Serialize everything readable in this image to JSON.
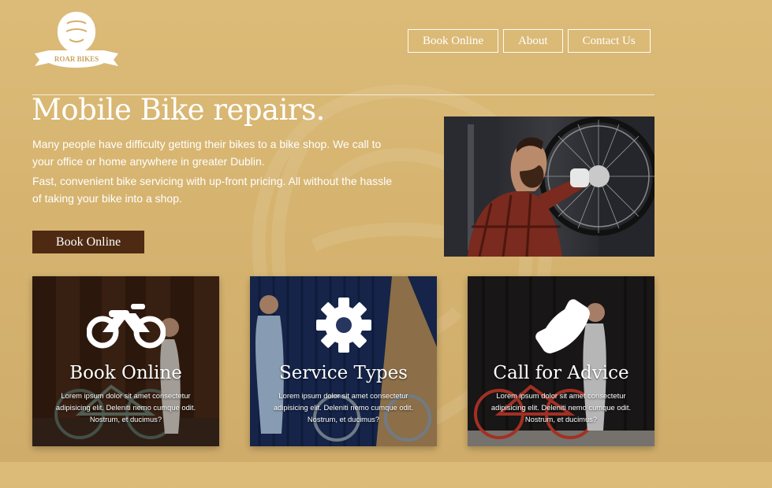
{
  "brand": {
    "logo_text": "ROAR BIKES"
  },
  "nav": {
    "items": [
      "Book Online",
      "About",
      "Contact Us"
    ]
  },
  "hero": {
    "title": "Mobile Bike repairs.",
    "paragraph_1": "Many people have difficulty getting their bikes to a bike shop. We call to your office or home anywhere in greater Dublin.",
    "paragraph_2": "Fast, convenient bike servicing with up-front pricing. All without the hassle of taking your bike into a shop.",
    "cta_label": "Book Online"
  },
  "cards": [
    {
      "title": "Book Online",
      "text": "Lorem ipsum dolor sit amet consectetur adipisicing elit. Deleniti nemo cumque odit. Nostrum, et ducimus?",
      "icon": "motorbike-icon"
    },
    {
      "title": "Service Types",
      "text": "Lorem ipsum dolor sit amet consectetur adipisicing elit. Deleniti nemo cumque odit. Nostrum, et ducimus?",
      "icon": "gear-icon"
    },
    {
      "title": "Call for Advice",
      "text": "Lorem ipsum dolor sit amet consectetur adipisicing elit. Deleniti nemo cumque odit. Nostrum, et ducimus?",
      "icon": "phone-icon"
    }
  ],
  "colors": {
    "background": "#dcbb78",
    "cta": "#4e2a12",
    "text": "#ffffff"
  }
}
